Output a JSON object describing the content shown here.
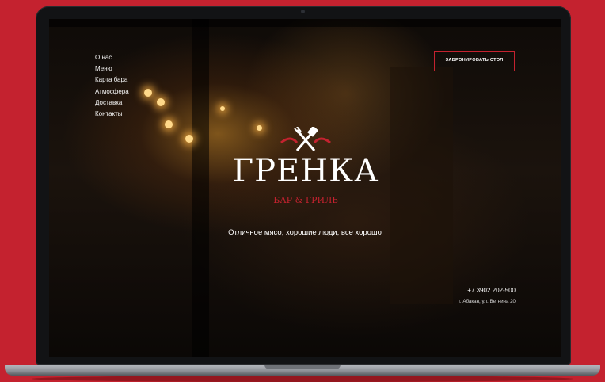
{
  "nav": {
    "items": [
      {
        "label": "О нас"
      },
      {
        "label": "Меню"
      },
      {
        "label": "Карта бара"
      },
      {
        "label": "Атмосфера"
      },
      {
        "label": "Доставка"
      },
      {
        "label": "Контакты"
      }
    ]
  },
  "header": {
    "reserve_label": "ЗАБРОНИРОВАТЬ СТОЛ"
  },
  "logo": {
    "title": "ГРЕНКА",
    "subtitle": "БАР & ГРИЛЬ"
  },
  "hero": {
    "tagline": "Отличное мясо, хорошие люди, все хорошо"
  },
  "contacts": {
    "phone": "+7 3902 202-500",
    "address": "г. Абакан, ул. Ветнина 20"
  },
  "colors": {
    "brand_red": "#c4222f",
    "background": "#c4222f",
    "text": "#ffffff"
  }
}
